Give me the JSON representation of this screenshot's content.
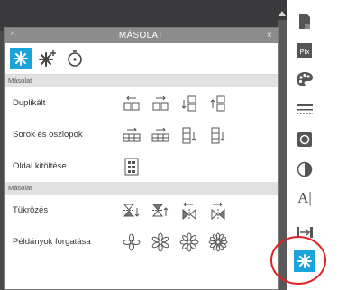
{
  "panel": {
    "title": "MÁSOLAT",
    "collapse_icon": "chevron-up-icon",
    "close_icon": "close-icon",
    "tools": [
      {
        "icon": "sparkle-icon",
        "active": true
      },
      {
        "icon": "sparkle-plus-icon",
        "active": false
      },
      {
        "icon": "rotate-target-icon",
        "active": false
      }
    ]
  },
  "sections": [
    {
      "header": "Másolat",
      "rows": [
        {
          "label": "Duplikált",
          "icons": [
            "duplicate-left-icon",
            "duplicate-right-icon",
            "duplicate-down-icon",
            "duplicate-up-icon"
          ]
        },
        {
          "label": "Sorok és oszlopok",
          "icons": [
            "rows-left-icon",
            "rows-right-icon",
            "columns-down-icon",
            "columns-up-icon"
          ]
        },
        {
          "label": "Oldal kitöltése",
          "icons": [
            "fill-page-icon"
          ]
        }
      ]
    },
    {
      "header": "Másolat",
      "rows": [
        {
          "label": "Tükrözés",
          "icons": [
            "mirror-down-icon",
            "mirror-up-icon",
            "mirror-left-icon",
            "mirror-right-icon"
          ]
        },
        {
          "label": "Példányok forgatása",
          "icons": [
            "rotate-4-icon",
            "rotate-6-icon",
            "rotate-8-icon",
            "rotate-12-icon"
          ]
        }
      ]
    }
  ],
  "sidebar": {
    "items": [
      {
        "icon": "page-icon"
      },
      {
        "icon": "pix-icon"
      },
      {
        "icon": "palette-icon"
      },
      {
        "icon": "lines-icon"
      },
      {
        "icon": "image-effect-icon"
      },
      {
        "icon": "contrast-icon"
      },
      {
        "icon": "text-icon",
        "label": "A|"
      },
      {
        "icon": "align-icon"
      },
      {
        "icon": "replicate-icon",
        "active": true
      }
    ]
  },
  "colors": {
    "accent": "#1aa4d9",
    "highlight": "#e22126",
    "title_bar": "#8c8c8c"
  }
}
